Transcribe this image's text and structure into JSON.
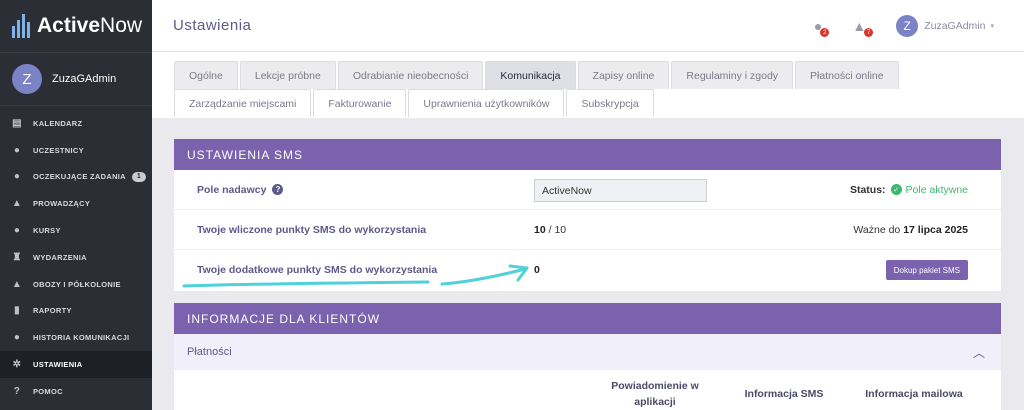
{
  "app": {
    "brand_active": "Active",
    "brand_now": "Now"
  },
  "sidebar": {
    "user": {
      "initial": "Z",
      "name": "ZuzaGAdmin"
    },
    "items": [
      {
        "label": "KALENDARZ",
        "icon": "calendar-icon"
      },
      {
        "label": "UCZESTNICY",
        "icon": "user-icon"
      },
      {
        "label": "OCZEKUJĄCE ZADANIA",
        "icon": "user-clock-icon",
        "badge": "1"
      },
      {
        "label": "PROWADZĄCY",
        "icon": "graduation-cap-icon"
      },
      {
        "label": "KURSY",
        "icon": "users-icon"
      },
      {
        "label": "WYDARZENIA",
        "icon": "trophy-icon"
      },
      {
        "label": "OBOZY I PÓŁKOLONIE",
        "icon": "tent-icon"
      },
      {
        "label": "RAPORTY",
        "icon": "chart-icon"
      },
      {
        "label": "HISTORIA KOMUNIKACJI",
        "icon": "chat-icon"
      },
      {
        "label": "USTAWIENIA",
        "icon": "gear-icon",
        "active": true
      },
      {
        "label": "POMOC",
        "icon": "help-icon"
      }
    ]
  },
  "topbar": {
    "title": "Ustawienia",
    "messages_badge": "2",
    "bell_badge": "7",
    "user_initial": "Z",
    "user_name": "ZuzaGAdmin"
  },
  "tabs": {
    "row1": [
      "Ogólne",
      "Lekcje próbne",
      "Odrabianie nieobecności",
      "Komunikacja",
      "Zapisy online",
      "Regulaminy i zgody",
      "Płatności online"
    ],
    "row2": [
      "Zarządzanie miejscami",
      "Fakturowanie",
      "Uprawnienia użytkowników",
      "Subskrypcja"
    ],
    "active": "Komunikacja"
  },
  "sms": {
    "heading": "USTAWIENIA SMS",
    "sender_label": "Pole nadawcy",
    "sender_value": "ActiveNow",
    "status_label": "Status:",
    "status_value": "Pole aktywne",
    "status_color": "#3cb86e",
    "included_label": "Twoje wliczone punkty SMS do wykorzystania",
    "included_used": "10",
    "included_total": "/ 10",
    "valid_prefix": "Ważne do",
    "valid_date": "17 lipca 2025",
    "extra_label": "Twoje dodatkowe punkty SMS do wykorzystania",
    "extra_value": "0",
    "buy_button": "Dokup pakiet SMS"
  },
  "info": {
    "heading": "INFORMACJE DLA KLIENTÓW",
    "section": "Płatności",
    "col_app": "Powiadomienie w aplikacji",
    "col_sms": "Informacja SMS",
    "col_mail": "Informacja mailowa"
  },
  "colors": {
    "accent": "#7a62ae",
    "sidebar": "#2b2e34",
    "annotation": "#4fd1d9"
  }
}
